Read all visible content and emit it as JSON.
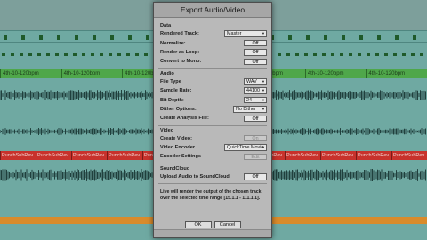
{
  "dialog": {
    "title": "Export Audio/Video",
    "sections": {
      "data": "Data",
      "audio": "Audio",
      "video": "Video",
      "soundcloud": "SoundCloud"
    },
    "rows": {
      "rendered_track": {
        "label": "Rendered Track:",
        "value": "Master"
      },
      "normalize": {
        "label": "Normalize:",
        "value": "Off"
      },
      "render_as_loop": {
        "label": "Render as Loop:",
        "value": "Off"
      },
      "convert_to_mono": {
        "label": "Convert to Mono:",
        "value": "Off"
      },
      "file_type": {
        "label": "File Type",
        "value": "WAV"
      },
      "sample_rate": {
        "label": "Sample Rate:",
        "value": "44100"
      },
      "bit_depth": {
        "label": "Bit Depth:",
        "value": "24"
      },
      "dither_options": {
        "label": "Dither Options:",
        "value": "No Dither"
      },
      "create_analysis_file": {
        "label": "Create Analysis File:",
        "value": "Off"
      },
      "create_video": {
        "label": "Create Video:",
        "value": "On"
      },
      "video_encoder": {
        "label": "Video Encoder",
        "value": "QuickTime Movie"
      },
      "encoder_settings": {
        "label": "Encoder Settings",
        "value": "Edit"
      },
      "upload_soundcloud": {
        "label": "Upload Audio to SoundCloud",
        "value": "Off"
      }
    },
    "info": "Live will render the output of the chosen track over the selected time range [15.1.1 - 111.1.1].",
    "buttons": {
      "ok": "OK",
      "cancel": "Cancel"
    }
  },
  "background": {
    "green_clips": [
      "4th-10-120bpm",
      "4th-10-120bpm",
      "4th-10-120bpm",
      "4th-10-120bpm",
      "4th-10-120bpm",
      "4th-10-120bpm",
      "4th-10-120bpm"
    ],
    "red_clips": [
      "PunchSubRev",
      "PunchSubRev",
      "PunchSubRev",
      "PunchSubRev",
      "PunchSubRev",
      "PunchSubRev",
      "PunchSubRev",
      "PunchSubRev",
      "PunchSubRev",
      "PunchSubRev",
      "PunchSubRev",
      "PunchSubRev"
    ]
  },
  "colors": {
    "track_teal": "#6fa9a2",
    "clip_green": "#4fa74a",
    "clip_red": "#c8322c",
    "clip_orange": "#d98b2b",
    "dialog_bg": "#b9b9b9"
  }
}
